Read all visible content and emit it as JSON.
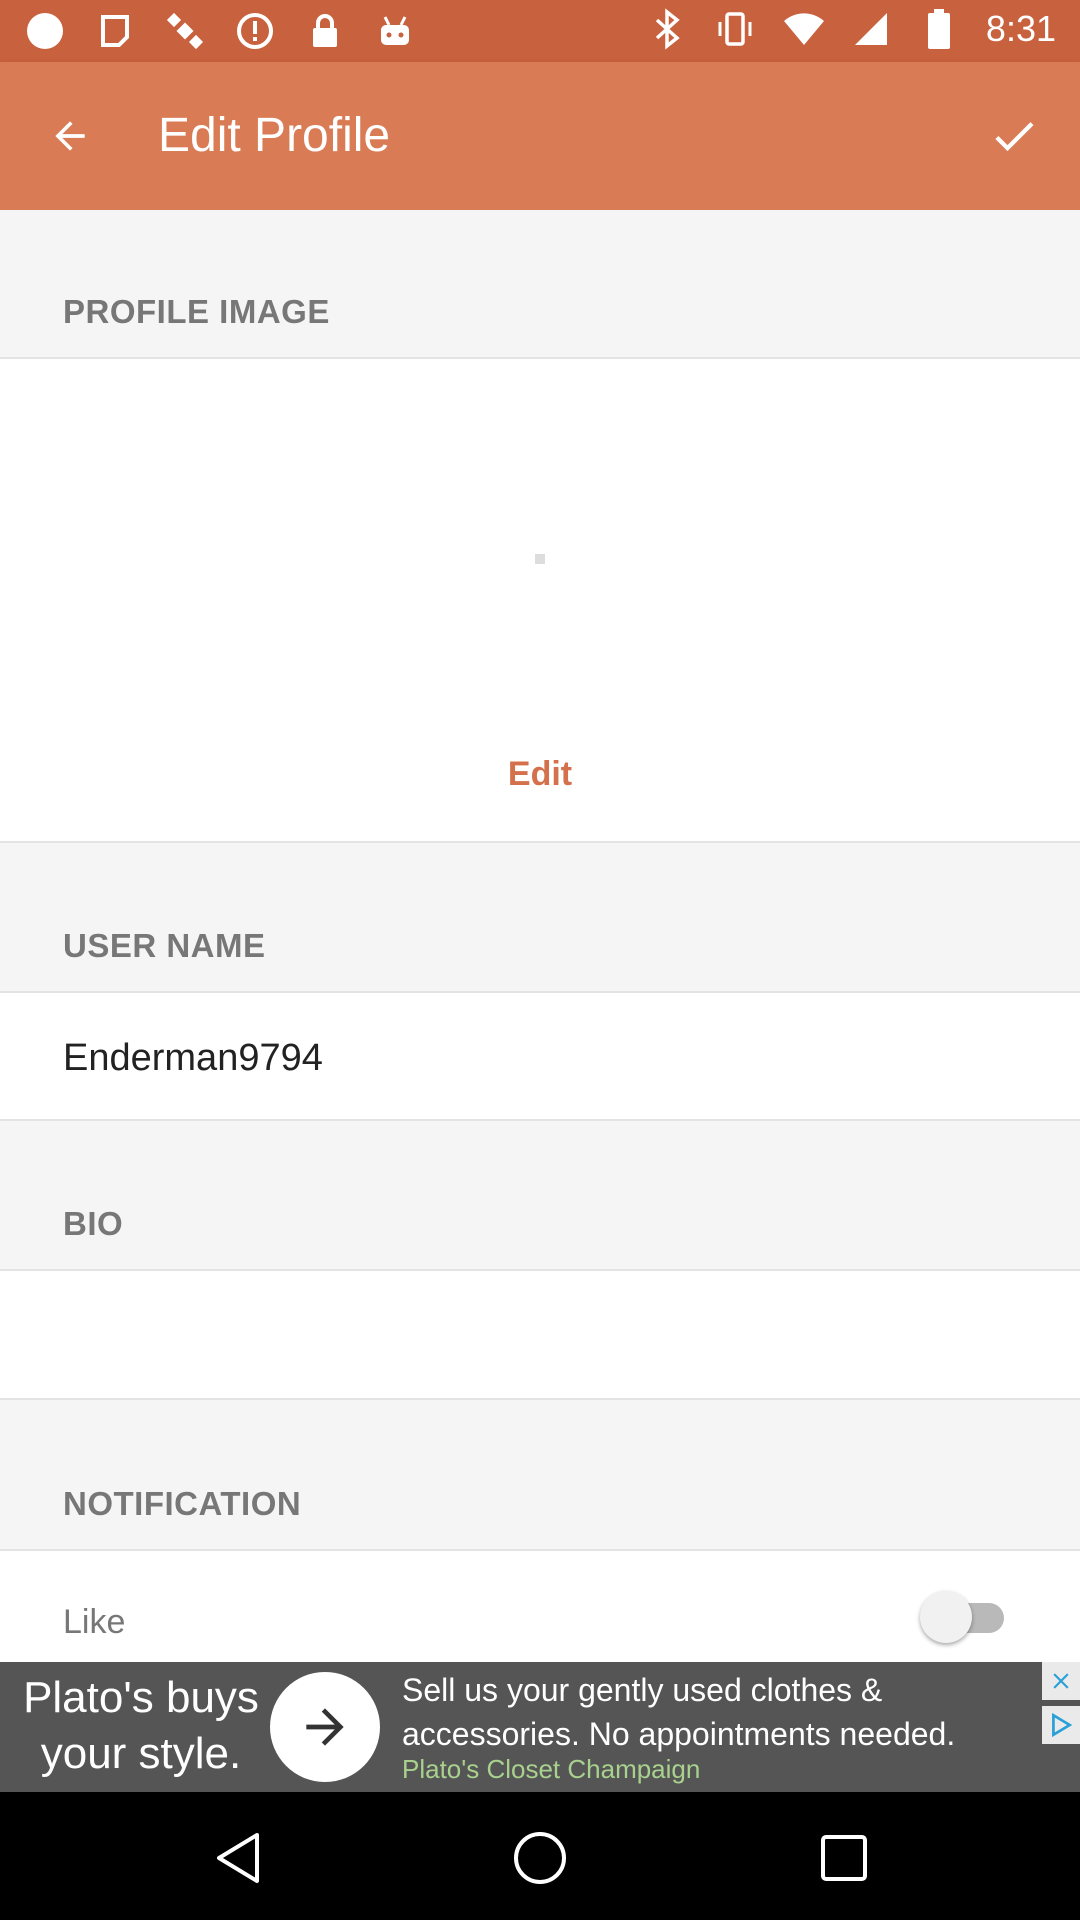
{
  "status_bar": {
    "time": "8:31",
    "left_icons": [
      "circle-icon",
      "fake-gps-icon",
      "satellite-icon",
      "alert-icon",
      "lock-icon",
      "android-icon"
    ],
    "right_icons": [
      "bluetooth-icon",
      "vibrate-icon",
      "wifi-icon",
      "signal-icon",
      "battery-icon"
    ]
  },
  "app_bar": {
    "title": "Edit Profile",
    "back_icon": "back-arrow-icon",
    "confirm_icon": "check-icon",
    "color": "#d97b54"
  },
  "sections": {
    "profile_image": {
      "header": "PROFILE IMAGE",
      "edit_label": "Edit"
    },
    "user_name": {
      "header": "USER NAME",
      "value": "Enderman9794"
    },
    "bio": {
      "header": "BIO",
      "value": ""
    },
    "notification": {
      "header": "NOTIFICATION",
      "like_label": "Like",
      "like_enabled": false
    }
  },
  "ad": {
    "left_text": "Plato's buys your style.",
    "message": "Sell us your gently used clothes & accessories. No appointments needed.",
    "sponsor": "Plato's Closet Champaign"
  },
  "nav_bar": {
    "buttons": [
      "back-triangle-icon",
      "home-circle-icon",
      "recents-square-icon"
    ]
  },
  "colors": {
    "accent": "#d4704b",
    "status_bar": "#c8613d"
  }
}
